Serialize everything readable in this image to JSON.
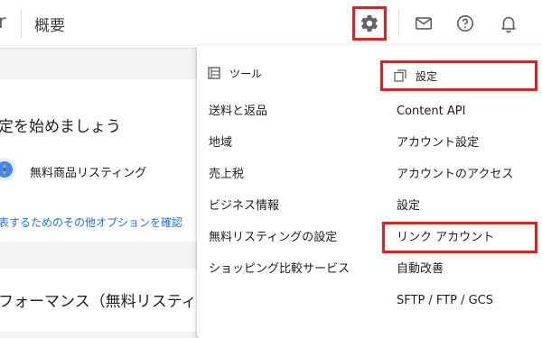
{
  "header": {
    "brand_fragment": "r",
    "page_title": "概要",
    "icons": [
      "settings-gear-icon",
      "mail-icon",
      "help-icon",
      "notifications-bell-icon"
    ]
  },
  "main": {
    "card1": {
      "heading": "定を始めましょう",
      "listing_label": "無料商品リスティング",
      "more_link": "表するためのその他オプションを確認"
    },
    "card2": {
      "heading": "フォーマンス（無料リスティ"
    }
  },
  "menu": {
    "tools": {
      "label": "ツール",
      "items": [
        {
          "label": "送料と返品"
        },
        {
          "label": "地域"
        },
        {
          "label": "売上税"
        },
        {
          "label": "ビジネス情報"
        },
        {
          "label": "無料リスティングの設定"
        },
        {
          "label": "ショッピング比較サービス"
        }
      ]
    },
    "settings": {
      "label": "設定",
      "items": [
        {
          "label": "Content API"
        },
        {
          "label": "アカウント設定"
        },
        {
          "label": "アカウントのアクセス"
        },
        {
          "label": "設定"
        },
        {
          "label": "リンク アカウント"
        },
        {
          "label": "自動改善"
        },
        {
          "label": "SFTP / FTP / GCS"
        }
      ]
    }
  },
  "colors": {
    "highlight": "#ea1c1c",
    "link": "#1a73e8",
    "page_bg": "#f1f3f4"
  }
}
